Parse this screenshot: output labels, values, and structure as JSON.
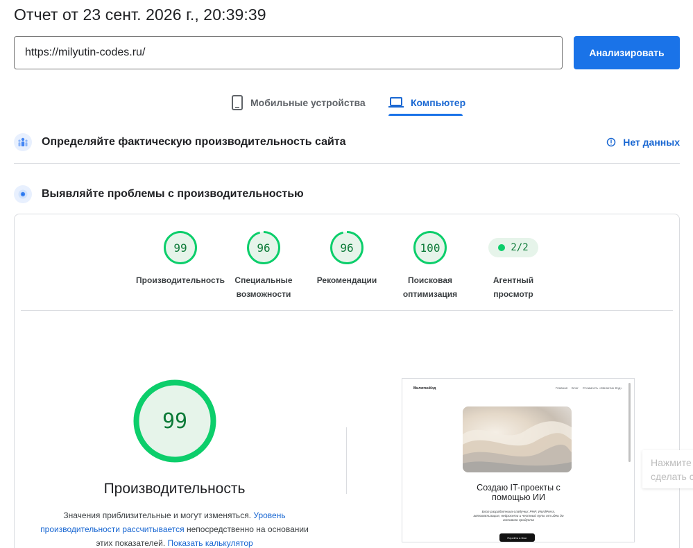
{
  "report": {
    "title": "Отчет от 23 сент. 2026 г., 20:39:39"
  },
  "search": {
    "url": "https://milyutin-codes.ru/",
    "button_label": "Анализировать"
  },
  "tabs": [
    {
      "label": "Мобильные устройства",
      "icon": "smartphone-icon",
      "active": false
    },
    {
      "label": "Компьютер",
      "icon": "laptop-icon",
      "active": true
    }
  ],
  "field_data": {
    "title": "Определяйте фактическую производительность сайта",
    "status": "Нет данных"
  },
  "lab_data": {
    "title": "Выявляйте проблемы с производительностью"
  },
  "scores": [
    {
      "value": 99,
      "label_line1": "Производительность",
      "label_line2": ""
    },
    {
      "value": 96,
      "label_line1": "Специальные",
      "label_line2": "возможности"
    },
    {
      "value": 96,
      "label_line1": "Рекомендации",
      "label_line2": ""
    },
    {
      "value": 100,
      "label_line1": "Поисковая",
      "label_line2": "оптимизация"
    }
  ],
  "agent_view": {
    "value": "2/2",
    "label_line1": "Агентный",
    "label_line2": "просмотр"
  },
  "performance": {
    "score": 99,
    "title": "Производительность",
    "desc_part1": "Значения приблизительные и могут изменяться.",
    "desc_link1": "Уровень производительности рассчитывается",
    "desc_part2": "непосредственно на основании этих показателей.",
    "desc_link2": "Показать калькулятор"
  },
  "screenshot_preview": {
    "logo": "МилютинКод",
    "nav": [
      "Главная",
      "Блог",
      "Стоимость «Милютин Код»"
    ],
    "headline": "Создаю IT-проекты с помощью ИИ",
    "subtext": "Блог разработчика-слабучки: PHP, WordPress, автоматизация, нейросети и честный путь от идеи до готового продукта",
    "button": "Перейти в блог"
  },
  "toast": {
    "line1": "Нажмите",
    "line2": "сделать с"
  },
  "colors": {
    "accent": "#1a73e8",
    "pass_green": "#0cce6b",
    "pass_text": "#0c7a38",
    "pass_bg": "#e6f4ea"
  }
}
